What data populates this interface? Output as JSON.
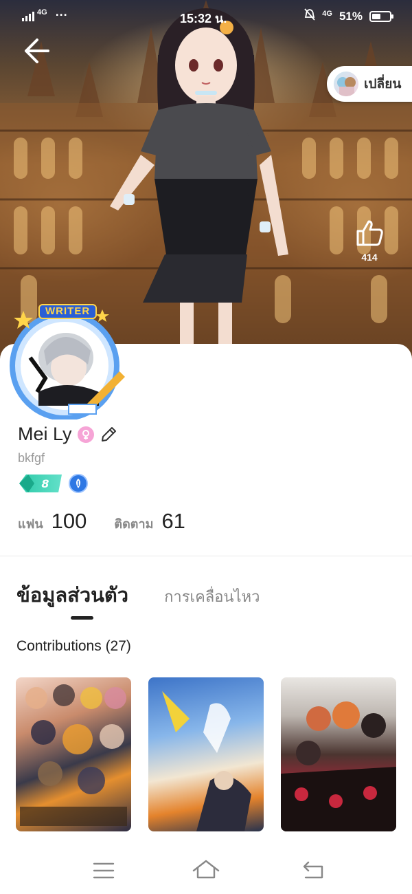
{
  "status_bar": {
    "network": "4G",
    "dots": "···",
    "time": "15:32 น.",
    "right_network": "4G",
    "battery_text": "51%",
    "battery_level": 0.51
  },
  "hero": {
    "change_button_label": "เปลี่ยน",
    "like_count": "414"
  },
  "profile": {
    "avatar_badge": "WRITER",
    "name": "Mei Ly",
    "username": "bkfgf",
    "level": "8",
    "stats": {
      "fans_label": "แฟน",
      "fans_value": "100",
      "following_label": "ติดตาม",
      "following_value": "61"
    }
  },
  "tabs": [
    {
      "label": "ข้อมูลส่วนตัว",
      "active": true
    },
    {
      "label": "การเคลื่อนไหว",
      "active": false
    }
  ],
  "contributions": {
    "title": "Contributions (27)"
  },
  "colors": {
    "accent": "#2ccaa8",
    "badge_blue": "#2e78e4",
    "gender_pink": "#f6a4d6"
  },
  "icons": {
    "back": "arrow-left-icon",
    "like": "thumbs-up-icon",
    "gender": "female-icon",
    "edit": "pencil-icon",
    "nav_menu": "menu-icon",
    "nav_home": "home-icon",
    "nav_back": "return-icon"
  }
}
